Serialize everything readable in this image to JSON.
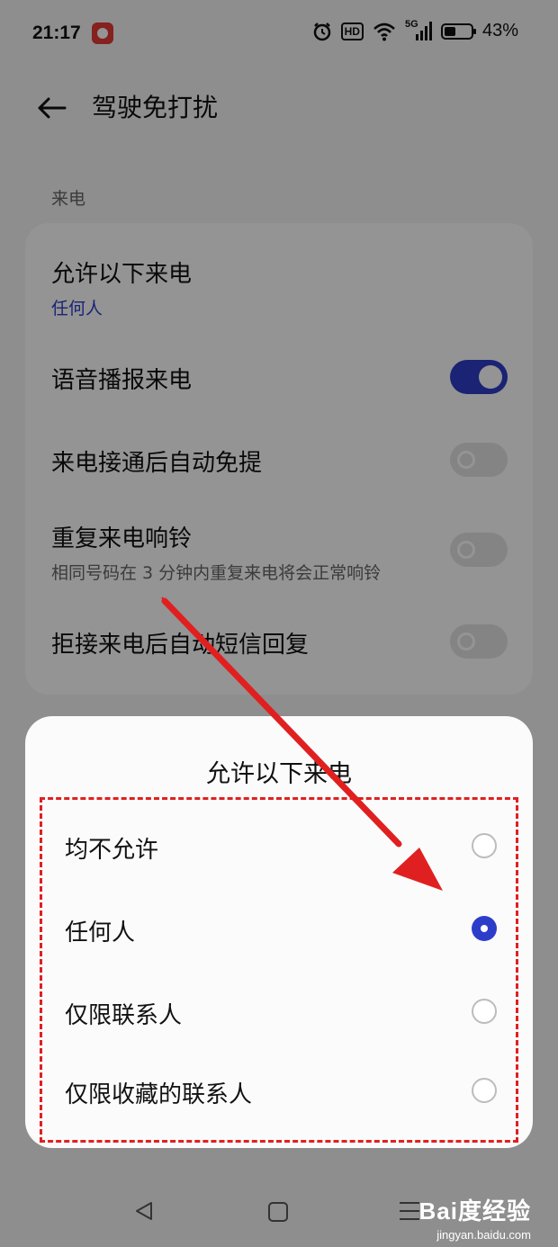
{
  "status_bar": {
    "time": "21:17",
    "network": "5G",
    "battery_text": "43%",
    "battery_level": 0.43,
    "hd_label": "HD",
    "icons": [
      "video-app-icon",
      "alarm-icon",
      "hd-icon",
      "wifi-icon",
      "signal-icon",
      "battery-icon"
    ]
  },
  "header": {
    "title": "驾驶免打扰",
    "back_icon": "back-arrow-icon"
  },
  "section": {
    "label": "来电"
  },
  "settings": {
    "allow_calls": {
      "title": "允许以下来电",
      "value": "任何人"
    },
    "voice_announce": {
      "title": "语音播报来电",
      "enabled": true
    },
    "auto_handsfree": {
      "title": "来电接通后自动免提",
      "enabled": false
    },
    "repeat_ring": {
      "title": "重复来电响铃",
      "subtitle": "相同号码在 3 分钟内重复来电将会正常响铃",
      "enabled": false
    },
    "auto_sms": {
      "title": "拒接来电后自动短信回复",
      "enabled": false
    }
  },
  "dialog": {
    "title": "允许以下来电",
    "options": [
      {
        "label": "均不允许",
        "selected": false
      },
      {
        "label": "任何人",
        "selected": true
      },
      {
        "label": "仅限联系人",
        "selected": false
      },
      {
        "label": "仅限收藏的联系人",
        "selected": false
      }
    ]
  },
  "nav_bar": {
    "icons": [
      "nav-back-icon",
      "nav-home-icon",
      "nav-menu-icon"
    ]
  },
  "watermark": {
    "main": "Bai度经验",
    "sub": "jingyan.baidu.com"
  },
  "colors": {
    "accent": "#2e3dc9",
    "annotation_red": "#e02020"
  }
}
